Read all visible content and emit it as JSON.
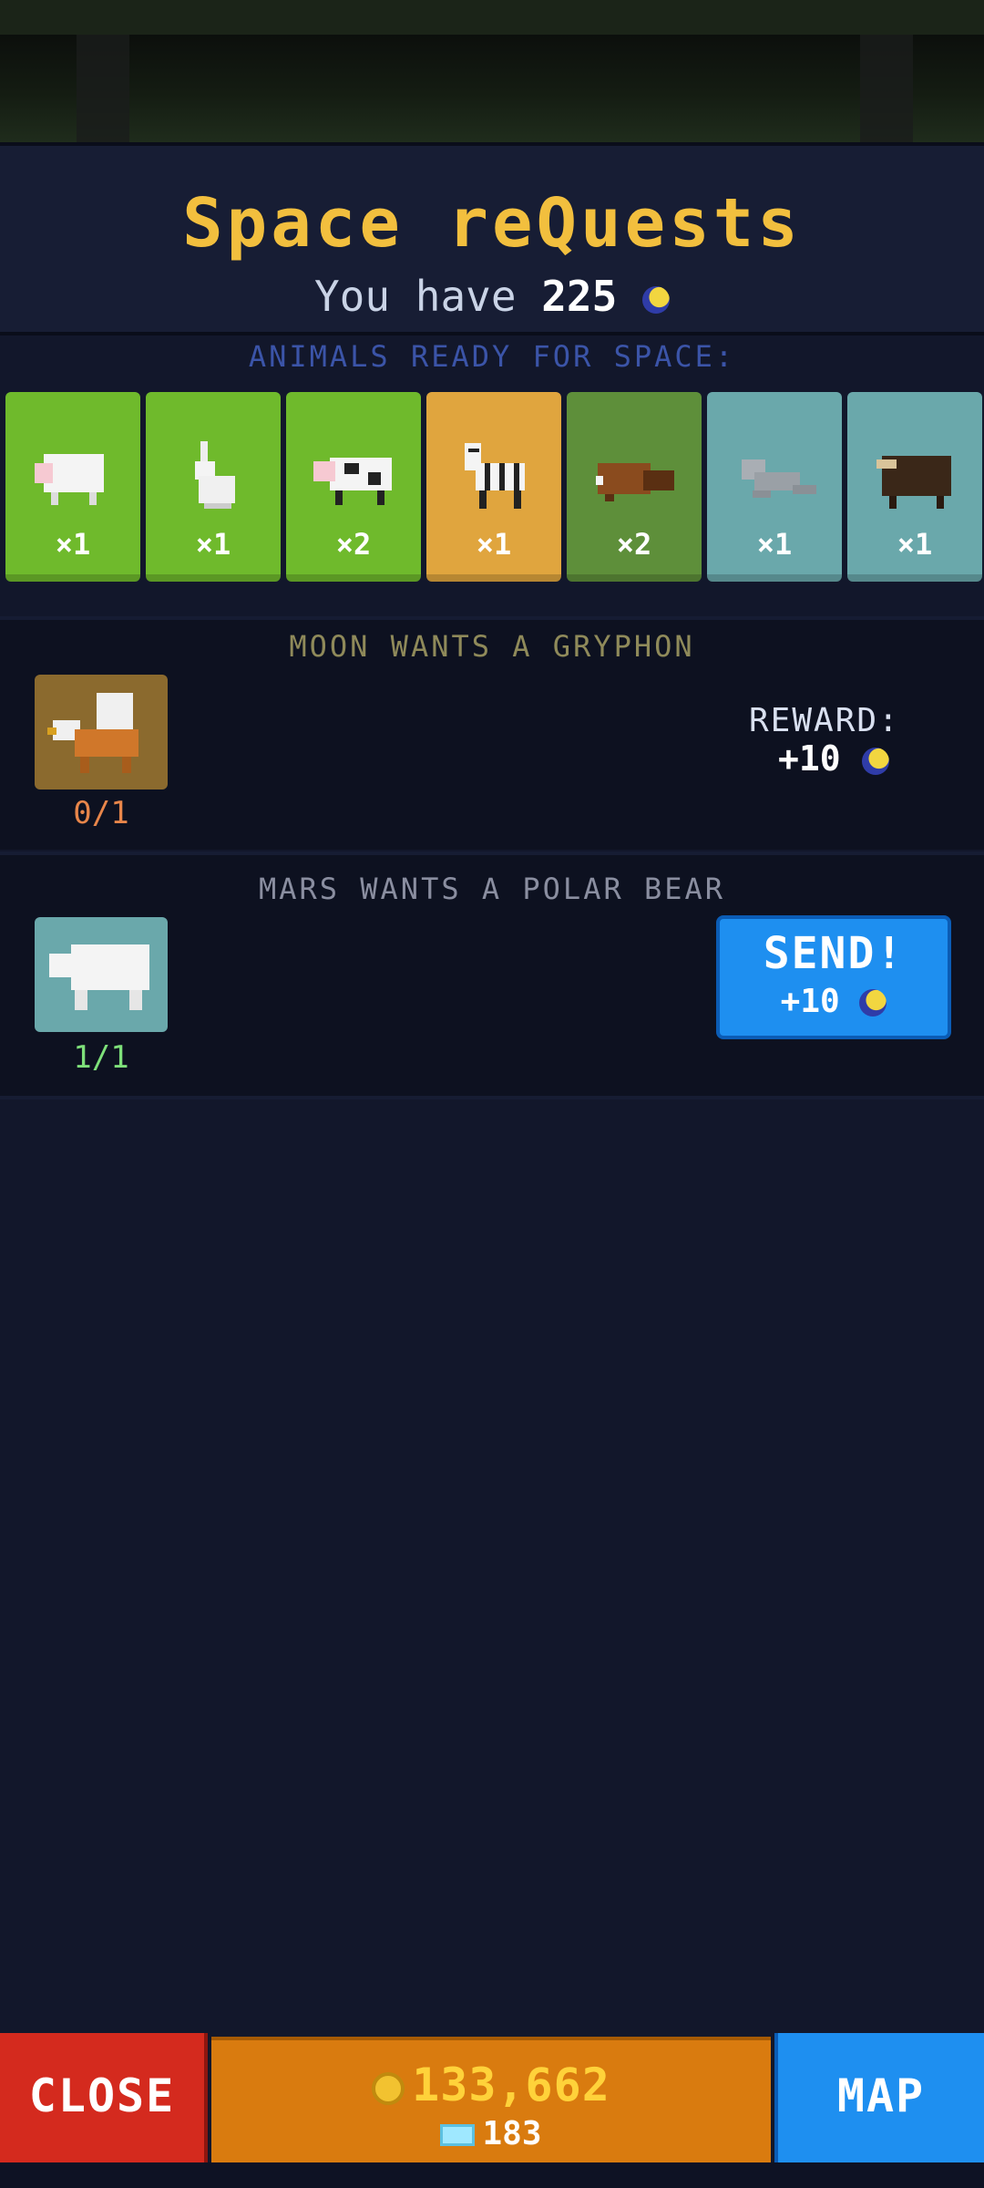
{
  "header": {
    "title": "Space reQuests",
    "balance_prefix": "You have",
    "balance_value": "225",
    "balance_icon": "moon-coin-icon"
  },
  "ready": {
    "label": "ANIMALS READY FOR SPACE:",
    "cards": [
      {
        "animal": "sheep",
        "qty": "×1",
        "bg": "#6fba2c"
      },
      {
        "animal": "rabbit",
        "qty": "×1",
        "bg": "#6fba2c"
      },
      {
        "animal": "cow",
        "qty": "×2",
        "bg": "#6fba2c"
      },
      {
        "animal": "zebra",
        "qty": "×1",
        "bg": "#e0a53e"
      },
      {
        "animal": "beaver",
        "qty": "×2",
        "bg": "#5e8f3a"
      },
      {
        "animal": "seal",
        "qty": "×1",
        "bg": "#6aa8ab"
      },
      {
        "animal": "musk-ox",
        "qty": "×1",
        "bg": "#6aa8ab"
      }
    ]
  },
  "requests": [
    {
      "title": "MOON WANTS A GRYPHON",
      "animal": "gryphon",
      "progress": "0/1",
      "reward_label": "REWARD:",
      "reward_value": "+10"
    },
    {
      "title": "MARS WANTS A POLAR BEAR",
      "animal": "polar-bear",
      "progress": "1/1",
      "send_label": "SEND!",
      "send_reward": "+10"
    }
  ],
  "footer": {
    "close_label": "CLOSE",
    "coins": "133,662",
    "gems": "183",
    "map_label": "MAP"
  },
  "colors": {
    "title": "#f2bf3e",
    "progress_incomplete": "#e8864a",
    "progress_complete": "#7ee07a",
    "send_button": "#1e8ff0",
    "close_button": "#d42a1e"
  }
}
